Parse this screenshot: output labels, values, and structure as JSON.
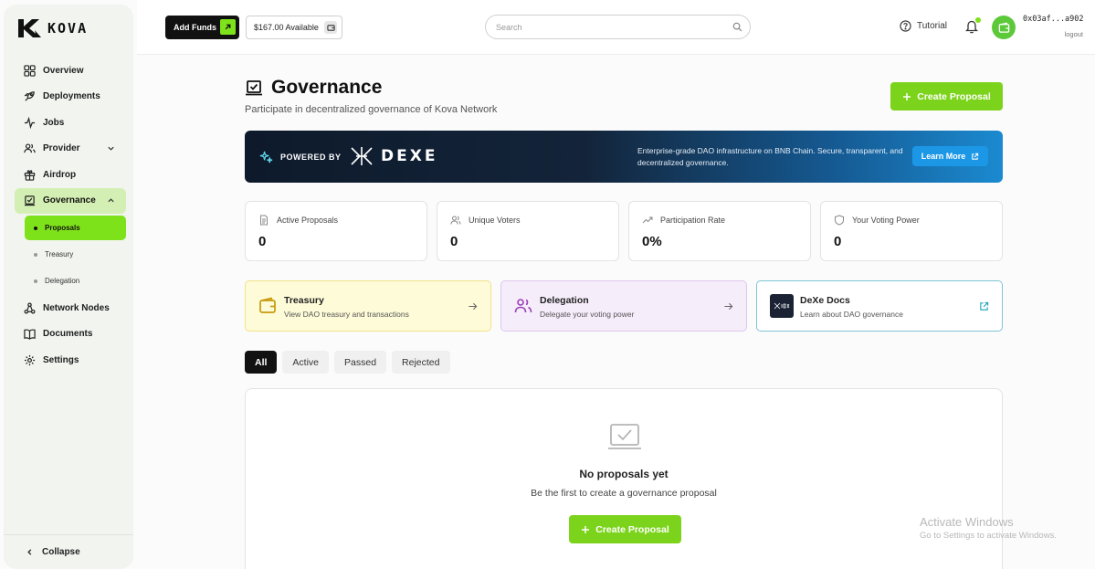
{
  "brand": {
    "name": "KOVA"
  },
  "sidebar": {
    "items": [
      {
        "label": "Overview"
      },
      {
        "label": "Deployments"
      },
      {
        "label": "Jobs"
      },
      {
        "label": "Provider"
      },
      {
        "label": "Airdrop"
      },
      {
        "label": "Governance"
      },
      {
        "label": "Network Nodes"
      },
      {
        "label": "Documents"
      },
      {
        "label": "Settings"
      }
    ],
    "governance_sub": [
      {
        "label": "Proposals"
      },
      {
        "label": "Treasury"
      },
      {
        "label": "Delegation"
      }
    ],
    "collapse_label": "Collapse"
  },
  "topbar": {
    "add_funds_label": "Add Funds",
    "balance": "$167.00 Available",
    "search_placeholder": "Search",
    "tutorial_label": "Tutorial",
    "wallet_address": "0x03af...a902",
    "logout_label": "logout"
  },
  "page": {
    "title": "Governance",
    "subtitle": "Participate in decentralized governance of Kova Network",
    "create_button": "Create Proposal"
  },
  "banner": {
    "powered_by": "POWERED BY",
    "brand": "DEXE",
    "description": "Enterprise-grade DAO infrastructure on BNB Chain. Secure, transparent, and decentralized governance.",
    "learn_more": "Learn More"
  },
  "stats": [
    {
      "label": "Active Proposals",
      "value": "0"
    },
    {
      "label": "Unique Voters",
      "value": "0"
    },
    {
      "label": "Participation Rate",
      "value": "0%"
    },
    {
      "label": "Your Voting Power",
      "value": "0"
    }
  ],
  "quick_links": [
    {
      "title": "Treasury",
      "subtitle": "View DAO treasury and transactions"
    },
    {
      "title": "Delegation",
      "subtitle": "Delegate your voting power"
    },
    {
      "title": "DeXe Docs",
      "subtitle": "Learn about DAO governance"
    }
  ],
  "tabs": [
    {
      "label": "All"
    },
    {
      "label": "Active"
    },
    {
      "label": "Passed"
    },
    {
      "label": "Rejected"
    }
  ],
  "empty_state": {
    "title": "No proposals yet",
    "subtitle": "Be the first to create a governance proposal",
    "button": "Create Proposal"
  },
  "watermark": {
    "line1": "Activate Windows",
    "line2": "Go to Settings to activate Windows."
  },
  "colors": {
    "accent_green": "#7cd31b",
    "active_nav": "#d4efb3",
    "banner_dark": "#0e1a2b",
    "banner_blue": "#1b8ad0"
  }
}
